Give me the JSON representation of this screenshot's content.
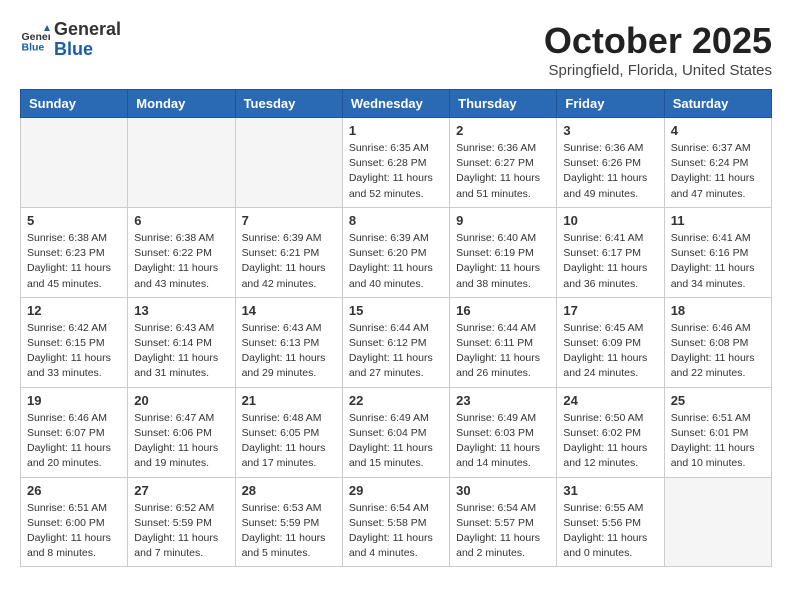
{
  "header": {
    "logo": {
      "general": "General",
      "blue": "Blue"
    },
    "month": "October 2025",
    "location": "Springfield, Florida, United States"
  },
  "weekdays": [
    "Sunday",
    "Monday",
    "Tuesday",
    "Wednesday",
    "Thursday",
    "Friday",
    "Saturday"
  ],
  "weeks": [
    [
      {
        "day": "",
        "info": ""
      },
      {
        "day": "",
        "info": ""
      },
      {
        "day": "",
        "info": ""
      },
      {
        "day": "1",
        "info": "Sunrise: 6:35 AM\nSunset: 6:28 PM\nDaylight: 11 hours and 52 minutes."
      },
      {
        "day": "2",
        "info": "Sunrise: 6:36 AM\nSunset: 6:27 PM\nDaylight: 11 hours and 51 minutes."
      },
      {
        "day": "3",
        "info": "Sunrise: 6:36 AM\nSunset: 6:26 PM\nDaylight: 11 hours and 49 minutes."
      },
      {
        "day": "4",
        "info": "Sunrise: 6:37 AM\nSunset: 6:24 PM\nDaylight: 11 hours and 47 minutes."
      }
    ],
    [
      {
        "day": "5",
        "info": "Sunrise: 6:38 AM\nSunset: 6:23 PM\nDaylight: 11 hours and 45 minutes."
      },
      {
        "day": "6",
        "info": "Sunrise: 6:38 AM\nSunset: 6:22 PM\nDaylight: 11 hours and 43 minutes."
      },
      {
        "day": "7",
        "info": "Sunrise: 6:39 AM\nSunset: 6:21 PM\nDaylight: 11 hours and 42 minutes."
      },
      {
        "day": "8",
        "info": "Sunrise: 6:39 AM\nSunset: 6:20 PM\nDaylight: 11 hours and 40 minutes."
      },
      {
        "day": "9",
        "info": "Sunrise: 6:40 AM\nSunset: 6:19 PM\nDaylight: 11 hours and 38 minutes."
      },
      {
        "day": "10",
        "info": "Sunrise: 6:41 AM\nSunset: 6:17 PM\nDaylight: 11 hours and 36 minutes."
      },
      {
        "day": "11",
        "info": "Sunrise: 6:41 AM\nSunset: 6:16 PM\nDaylight: 11 hours and 34 minutes."
      }
    ],
    [
      {
        "day": "12",
        "info": "Sunrise: 6:42 AM\nSunset: 6:15 PM\nDaylight: 11 hours and 33 minutes."
      },
      {
        "day": "13",
        "info": "Sunrise: 6:43 AM\nSunset: 6:14 PM\nDaylight: 11 hours and 31 minutes."
      },
      {
        "day": "14",
        "info": "Sunrise: 6:43 AM\nSunset: 6:13 PM\nDaylight: 11 hours and 29 minutes."
      },
      {
        "day": "15",
        "info": "Sunrise: 6:44 AM\nSunset: 6:12 PM\nDaylight: 11 hours and 27 minutes."
      },
      {
        "day": "16",
        "info": "Sunrise: 6:44 AM\nSunset: 6:11 PM\nDaylight: 11 hours and 26 minutes."
      },
      {
        "day": "17",
        "info": "Sunrise: 6:45 AM\nSunset: 6:09 PM\nDaylight: 11 hours and 24 minutes."
      },
      {
        "day": "18",
        "info": "Sunrise: 6:46 AM\nSunset: 6:08 PM\nDaylight: 11 hours and 22 minutes."
      }
    ],
    [
      {
        "day": "19",
        "info": "Sunrise: 6:46 AM\nSunset: 6:07 PM\nDaylight: 11 hours and 20 minutes."
      },
      {
        "day": "20",
        "info": "Sunrise: 6:47 AM\nSunset: 6:06 PM\nDaylight: 11 hours and 19 minutes."
      },
      {
        "day": "21",
        "info": "Sunrise: 6:48 AM\nSunset: 6:05 PM\nDaylight: 11 hours and 17 minutes."
      },
      {
        "day": "22",
        "info": "Sunrise: 6:49 AM\nSunset: 6:04 PM\nDaylight: 11 hours and 15 minutes."
      },
      {
        "day": "23",
        "info": "Sunrise: 6:49 AM\nSunset: 6:03 PM\nDaylight: 11 hours and 14 minutes."
      },
      {
        "day": "24",
        "info": "Sunrise: 6:50 AM\nSunset: 6:02 PM\nDaylight: 11 hours and 12 minutes."
      },
      {
        "day": "25",
        "info": "Sunrise: 6:51 AM\nSunset: 6:01 PM\nDaylight: 11 hours and 10 minutes."
      }
    ],
    [
      {
        "day": "26",
        "info": "Sunrise: 6:51 AM\nSunset: 6:00 PM\nDaylight: 11 hours and 8 minutes."
      },
      {
        "day": "27",
        "info": "Sunrise: 6:52 AM\nSunset: 5:59 PM\nDaylight: 11 hours and 7 minutes."
      },
      {
        "day": "28",
        "info": "Sunrise: 6:53 AM\nSunset: 5:59 PM\nDaylight: 11 hours and 5 minutes."
      },
      {
        "day": "29",
        "info": "Sunrise: 6:54 AM\nSunset: 5:58 PM\nDaylight: 11 hours and 4 minutes."
      },
      {
        "day": "30",
        "info": "Sunrise: 6:54 AM\nSunset: 5:57 PM\nDaylight: 11 hours and 2 minutes."
      },
      {
        "day": "31",
        "info": "Sunrise: 6:55 AM\nSunset: 5:56 PM\nDaylight: 11 hours and 0 minutes."
      },
      {
        "day": "",
        "info": ""
      }
    ]
  ]
}
